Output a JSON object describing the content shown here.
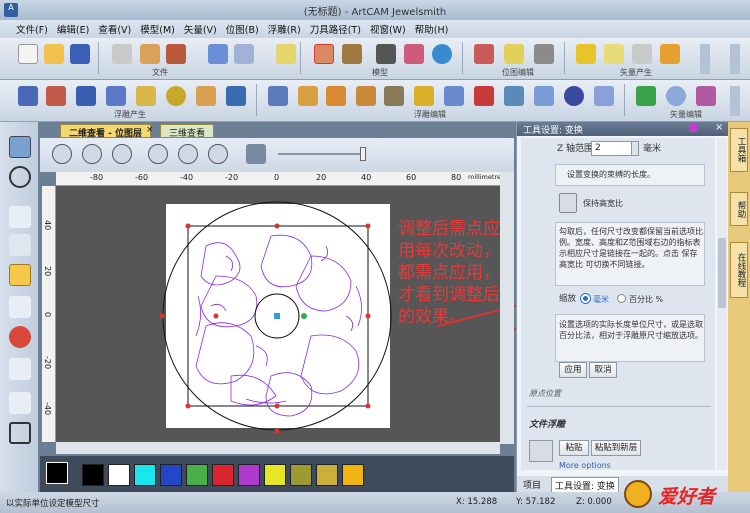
{
  "window": {
    "title": "(无标题) - ArtCAM Jewelsmith"
  },
  "menu": [
    "文件(F)",
    "编辑(E)",
    "查看(V)",
    "模型(M)",
    "矢量(V)",
    "位图(B)",
    "浮雕(R)",
    "刀具路径(T)",
    "视窗(W)",
    "帮助(H)"
  ],
  "ribbon": {
    "groups_row1": [
      "文件",
      "模型",
      "位图编辑",
      "矢量产生"
    ],
    "groups_row2": [
      "浮雕产生",
      "浮雕编辑",
      "矢量编辑"
    ]
  },
  "view": {
    "tabs": [
      "二维查看 - 位图层",
      "三维查看"
    ],
    "ruler_h": [
      "-80",
      "-60",
      "-40",
      "-20",
      "0",
      "20",
      "40",
      "60",
      "80"
    ],
    "ruler_unit": "millimetres",
    "ruler_v": [
      "40",
      "20",
      "0",
      "-20",
      "-40"
    ]
  },
  "palette": {
    "colors": [
      "#000000",
      "#ffffff",
      "#19e6ee",
      "#2347c8",
      "#49b049",
      "#d9262e",
      "#b03ad0",
      "#e6e624",
      "#9c9a33",
      "#c9b03a",
      "#f0b510"
    ]
  },
  "annotation": {
    "text": "调整后需点应用每次改动，都需点应用，才看到调整后的效果。"
  },
  "panel": {
    "header": "工具设置: 变换",
    "z_range_label": "Z 轴范围",
    "z_range_value": "2",
    "z_unit": "毫米",
    "desc1": "设置变换的束缚的长度。",
    "keep_ratio": "保持高宽比",
    "desc2": "勾取后，任何尺寸改变都保留当前选项比例。宽度、高度和Z范围域右边的指标表示相应尺寸是链接在一起的。点击 保存高宽比 可切换不同链接。",
    "scale_label": "缩放",
    "scale_mm": "毫米",
    "scale_pct": "百分比 %",
    "desc3": "设置选项的实际长度单位尺寸，或是选取 百分比法，相对于浮雕原尺寸缩放选项。",
    "apply": "应用",
    "cancel": "取消",
    "origin": "原点位置",
    "relief_file": "文件浮雕",
    "paste": "粘贴",
    "paste_new": "粘贴到新层",
    "more": "More options",
    "tab_project": "项目",
    "tab_tool": "工具设置: 变换"
  },
  "side_tabs": [
    "工具箱",
    "帮助",
    "在线教程"
  ],
  "status": {
    "hint": "以实际单位设定模型尺寸",
    "x": "X: 15.288",
    "y": "Y: 57.182",
    "z": "Z: 0.000"
  },
  "logo": {
    "text": "爱好者"
  }
}
